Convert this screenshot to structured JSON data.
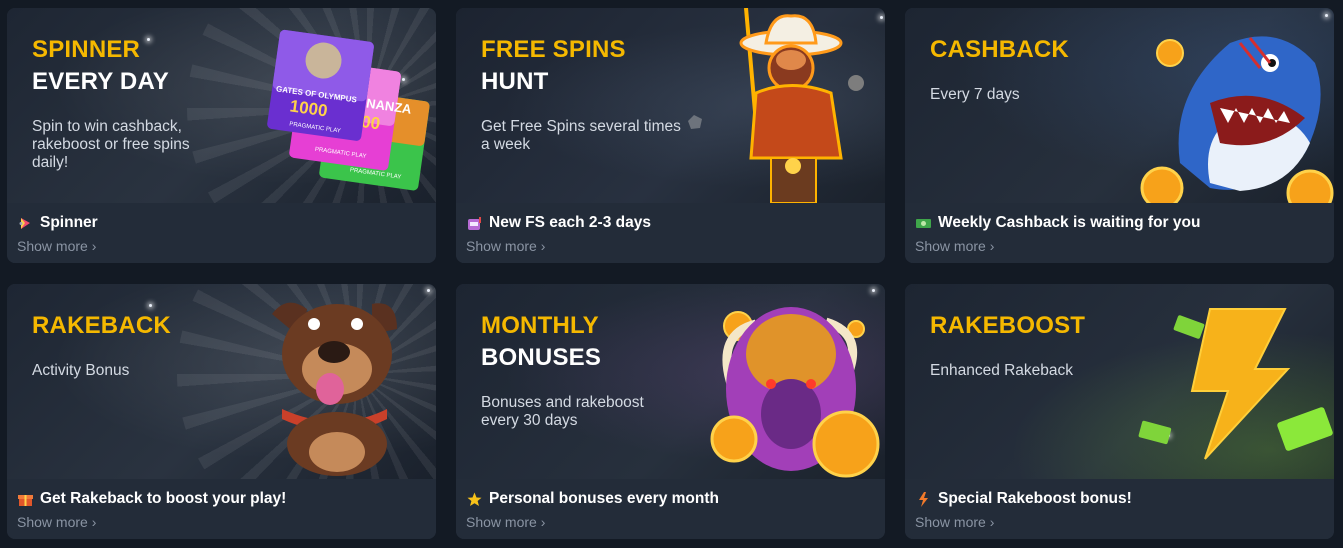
{
  "cards": [
    {
      "title_line1": "SPINNER",
      "title_line2": "EVERY DAY",
      "description": "Spin to win cashback, rakeboost or free spins daily!",
      "footer_title": "Spinner",
      "footer_icon": "spinner-icon",
      "show_more": "Show more",
      "art_texts": [
        "GATES OF OLYMPUS",
        "1000",
        "PRAGMATIC PLAY",
        "BONANZA",
        "1000",
        "PRAGMATIC PLAY",
        "PRAGMATIC PLAY"
      ]
    },
    {
      "title_line1": "FREE SPINS",
      "title_line2": "HUNT",
      "description": "Get Free Spins several times a week",
      "footer_title": "New FS each 2-3 days",
      "footer_icon": "slot-machine-icon",
      "show_more": "Show more"
    },
    {
      "title_line1": "CASHBACK",
      "title_line2": "",
      "description": "Every 7 days",
      "footer_title": "Weekly Cashback is waiting for you",
      "footer_icon": "money-icon",
      "show_more": "Show more"
    },
    {
      "title_line1": "RAKEBACK",
      "title_line2": "",
      "description": "Activity Bonus",
      "footer_title": "Get Rakeback to boost your play!",
      "footer_icon": "gift-icon",
      "show_more": "Show more"
    },
    {
      "title_line1": "MONTHLY",
      "title_line2": "BONUSES",
      "description": "Bonuses and rakeboost every 30 days",
      "footer_title": "Personal bonuses every month",
      "footer_icon": "star-icon",
      "show_more": "Show more"
    },
    {
      "title_line1": "RAKEBOOST",
      "title_line2": "",
      "description": "Enhanced Rakeback",
      "footer_title": "Special Rakeboost bonus!",
      "footer_icon": "lightning-icon",
      "show_more": "Show more"
    }
  ],
  "colors": {
    "page_bg": "#131a24",
    "card_bg": "#232c39",
    "title_accent": "#f5b800",
    "title_white": "#ffffff",
    "desc_text": "#d4dae3",
    "show_more_text": "#8a94a3"
  }
}
